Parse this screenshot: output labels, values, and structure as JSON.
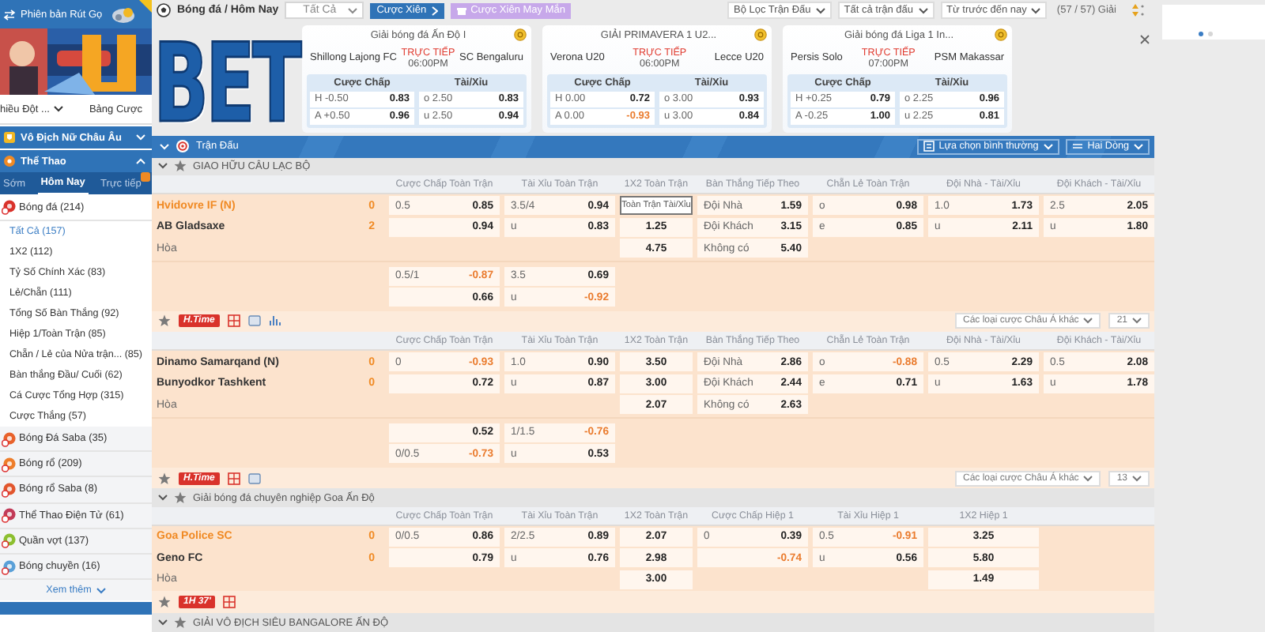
{
  "sidebar": {
    "compact_label": "Phiên bản Rút Gọ",
    "links": [
      {
        "label": "hiều Đột ...",
        "menu": true
      },
      {
        "label": "Bảng Cược",
        "menu": false
      }
    ],
    "featured": {
      "label": "Vô Địch Nữ Châu Âu",
      "expanded": false
    },
    "section": {
      "label": "Thể Thao",
      "expanded": true
    },
    "sport_tabs": [
      {
        "label": "Sớm",
        "selected": false,
        "badge": false
      },
      {
        "label": "Hôm Nay",
        "selected": true,
        "badge": false
      },
      {
        "label": "Trực tiếp",
        "selected": false,
        "badge": true
      }
    ],
    "sports": [
      {
        "label": "Bóng đá (214)",
        "kind": "soccer",
        "children": [
          {
            "label": "Tất Cả (157)",
            "selected": true
          },
          {
            "label": "1X2 (112)",
            "selected": false
          },
          {
            "label": "Tỷ Số Chính Xác (83)",
            "selected": false
          },
          {
            "label": "Lẻ/Chẵn (111)",
            "selected": false
          },
          {
            "label": "Tổng Số Bàn Thắng (92)",
            "selected": false
          },
          {
            "label": "Hiệp 1/Toàn Trận (85)",
            "selected": false
          },
          {
            "label": "Chẵn / Lẻ của Nửa trận... (85)",
            "selected": false
          },
          {
            "label": "Bàn thắng Đầu/ Cuối (62)",
            "selected": false
          },
          {
            "label": "Cá Cược Tổng Hợp (315)",
            "selected": false
          },
          {
            "label": "Cược Thắng (57)",
            "selected": false
          }
        ]
      },
      {
        "label": "Bóng Đá Saba (35)",
        "kind": "soccer-saba"
      },
      {
        "label": "Bóng rổ (209)",
        "kind": "basketball"
      },
      {
        "label": "Bóng rổ Saba (8)",
        "kind": "basketball-saba"
      },
      {
        "label": "Thể Thao Điện Tử (61)",
        "kind": "esports"
      },
      {
        "label": "Quần vợt (137)",
        "kind": "tennis"
      },
      {
        "label": "Bóng chuyền (16)",
        "kind": "volleyball"
      }
    ],
    "more": "Xem thêm"
  },
  "header": {
    "title": "Bóng đá / Hôm Nay",
    "filter": "Tất Cả",
    "buttons": [
      {
        "label": "Cược Xiên",
        "kind": "primary"
      },
      {
        "label": "Cược Xiên May Mắn",
        "kind": "lucky"
      }
    ],
    "dropdowns": [
      "Bộ Lọc Trận Đấu",
      "Tất cả trận đấu",
      "Từ trước đến nay"
    ],
    "league_count": "(57 / 57) Giải"
  },
  "logo": "BET",
  "cards": [
    {
      "league": "Giải bóng đá Ấn Độ I",
      "home": "Shillong Lajong FC",
      "away": "SC Bengaluru",
      "live": "TRỰC TIẾP",
      "time": "06:00PM",
      "handicap_title": "Cược Chấp",
      "total_title": "Tài/Xỉu",
      "rows": [
        [
          [
            "H -0.50",
            "0.83"
          ],
          [
            "o 2.50",
            "0.83"
          ]
        ],
        [
          [
            "A +0.50",
            "0.96"
          ],
          [
            "u 2.50",
            "0.94"
          ]
        ]
      ]
    },
    {
      "league": "GIẢI PRIMAVERA 1 U2...",
      "home": "Verona U20",
      "away": "Lecce U20",
      "live": "TRỰC TIẾP",
      "time": "06:00PM",
      "handicap_title": "Cược Chấp",
      "total_title": "Tài/Xỉu",
      "rows": [
        [
          [
            "H 0.00",
            "0.72"
          ],
          [
            "o 3.00",
            "0.93"
          ]
        ],
        [
          [
            "A 0.00",
            "-0.93"
          ],
          [
            "u 3.00",
            "0.84"
          ]
        ]
      ]
    },
    {
      "league": "Giải bóng đá Liga 1 In...",
      "home": "Persis Solo",
      "away": "PSM Makassar",
      "live": "TRỰC TIẾP",
      "time": "07:00PM",
      "handicap_title": "Cược Chấp",
      "total_title": "Tài/Xỉu",
      "rows": [
        [
          [
            "H +0.25",
            "0.79"
          ],
          [
            "o 2.25",
            "0.96"
          ]
        ],
        [
          [
            "A -0.25",
            "1.00"
          ],
          [
            "u 2.25",
            "0.81"
          ]
        ]
      ]
    }
  ],
  "carousel": [
    {
      "selected": true
    },
    {
      "selected": false
    }
  ],
  "board": {
    "title": "Trận Đấu",
    "options": [
      {
        "label": "Lựa chọn bình thường",
        "kind": "list"
      },
      {
        "label": "Hai Dòng",
        "kind": "lines"
      }
    ],
    "leagues": [
      {
        "name": "GIAO HỮU CÂU LẠC BỘ",
        "matches": [
          {
            "columns": [
              {
                "title": "Cược Chấp Toàn Trận",
                "kind": "pair"
              },
              {
                "title": "Tài Xỉu Toàn Trận",
                "kind": "pair"
              },
              {
                "title": "1X2 Toàn Trận",
                "kind": "single"
              },
              {
                "title": "Bàn Thắng Tiếp Theo",
                "kind": "pair"
              },
              {
                "title": "Chẵn Lẻ Toàn Trận",
                "kind": "pair"
              },
              {
                "title": "Đội Nhà - Tài/Xỉu",
                "kind": "pair"
              },
              {
                "title": "Đội Khách - Tài/Xỉu",
                "kind": "pair"
              }
            ],
            "home": {
              "name": "Hvidovre IF (N)",
              "score": "0",
              "highlight": true
            },
            "away": {
              "name": "AB Gladsaxe",
              "score": "2",
              "highlight": false
            },
            "draw": "Hòa",
            "rows": [
              [
                [
                  "0.5",
                  "0.85"
                ],
                [
                  "3.5/4",
                  "0.94"
                ],
                {
                  "tooltip": "Toàn Trận Tài/Xỉu"
                },
                [
                  "Đội Nhà",
                  "1.59"
                ],
                [
                  "o",
                  "0.98"
                ],
                [
                  "1.0",
                  "1.73"
                ],
                [
                  "2.5",
                  "2.05"
                ]
              ],
              [
                [
                  "0.94"
                ],
                [
                  "u",
                  "0.83"
                ],
                [
                  "1.25"
                ],
                [
                  "Đội Khách",
                  "3.15"
                ],
                [
                  "e",
                  "0.85"
                ],
                [
                  "u",
                  "2.11"
                ],
                [
                  "u",
                  "1.80"
                ]
              ],
              [
                null,
                null,
                [
                  "4.75"
                ],
                [
                  "Không có",
                  "5.40"
                ],
                null,
                null,
                null
              ]
            ],
            "extra_rows": [
              [
                [
                  "0.5/1",
                  "-0.87"
                ],
                [
                  "3.5",
                  "0.69"
                ]
              ],
              [
                [
                  "0.66"
                ],
                [
                  "u",
                  "-0.92"
                ]
              ]
            ],
            "badge": "H.Time",
            "tools": [
              {
                "kind": "grid"
              },
              {
                "kind": "box"
              },
              {
                "kind": "chart"
              }
            ],
            "more": {
              "label": "Các loại cược Châu Á khác",
              "count": "21"
            }
          },
          {
            "columns": [
              {
                "title": "Cược Chấp Toàn Trận",
                "kind": "pair"
              },
              {
                "title": "Tài Xỉu Toàn Trận",
                "kind": "pair"
              },
              {
                "title": "1X2 Toàn Trận",
                "kind": "single"
              },
              {
                "title": "Bàn Thắng Tiếp Theo",
                "kind": "pair"
              },
              {
                "title": "Chẵn Lẻ Toàn Trận",
                "kind": "pair"
              },
              {
                "title": "Đội Nhà - Tài/Xỉu",
                "kind": "pair"
              },
              {
                "title": "Đội Khách - Tài/Xỉu",
                "kind": "pair"
              }
            ],
            "home": {
              "name": "Dinamo Samarqand (N)",
              "score": "0",
              "highlight": false
            },
            "away": {
              "name": "Bunyodkor Tashkent",
              "score": "0",
              "highlight": false
            },
            "draw": "Hòa",
            "rows": [
              [
                [
                  "0",
                  "-0.93"
                ],
                [
                  "1.0",
                  "0.90"
                ],
                [
                  "3.50"
                ],
                [
                  "Đội Nhà",
                  "2.86"
                ],
                [
                  "o",
                  "-0.88"
                ],
                [
                  "0.5",
                  "2.29"
                ],
                [
                  "0.5",
                  "2.08"
                ]
              ],
              [
                [
                  "0.72"
                ],
                [
                  "u",
                  "0.87"
                ],
                [
                  "3.00"
                ],
                [
                  "Đội Khách",
                  "2.44"
                ],
                [
                  "e",
                  "0.71"
                ],
                [
                  "u",
                  "1.63"
                ],
                [
                  "u",
                  "1.78"
                ]
              ],
              [
                null,
                null,
                [
                  "2.07"
                ],
                [
                  "Không có",
                  "2.63"
                ],
                null,
                null,
                null
              ]
            ],
            "extra_rows": [
              [
                [
                  "0.52"
                ],
                [
                  "1/1.5",
                  "-0.76"
                ]
              ],
              [
                [
                  "0/0.5",
                  "-0.73"
                ],
                [
                  "u",
                  "0.53"
                ]
              ]
            ],
            "badge": "H.Time",
            "tools": [
              {
                "kind": "grid"
              },
              {
                "kind": "box"
              }
            ],
            "more": {
              "label": "Các loại cược Châu Á khác",
              "count": "13"
            }
          }
        ]
      },
      {
        "name": "Giải bóng đá chuyên nghiệp Goa Ấn Độ",
        "matches": [
          {
            "columns": [
              {
                "title": "Cược Chấp Toàn Trận",
                "kind": "pair"
              },
              {
                "title": "Tài Xỉu Toàn Trận",
                "kind": "pair"
              },
              {
                "title": "1X2 Toàn Trận",
                "kind": "single"
              },
              {
                "title": "Cược Chấp Hiệp 1",
                "kind": "pair"
              },
              {
                "title": "Tài Xỉu Hiệp 1",
                "kind": "pair"
              },
              {
                "title": "1X2 Hiệp 1",
                "kind": "single"
              }
            ],
            "home": {
              "name": "Goa Police SC",
              "score": "0",
              "highlight": true
            },
            "away": {
              "name": "Geno FC",
              "score": "0",
              "highlight": false
            },
            "draw": "Hòa",
            "rows": [
              [
                [
                  "0/0.5",
                  "0.86"
                ],
                [
                  "2/2.5",
                  "0.89"
                ],
                [
                  "2.07"
                ],
                [
                  "0",
                  "0.39"
                ],
                [
                  "0.5",
                  "-0.91"
                ],
                [
                  "3.25"
                ]
              ],
              [
                [
                  "0.79"
                ],
                [
                  "u",
                  "0.76"
                ],
                [
                  "2.98"
                ],
                [
                  "-0.74"
                ],
                [
                  "u",
                  "0.56"
                ],
                [
                  "5.80"
                ]
              ],
              [
                null,
                null,
                [
                  "3.00"
                ],
                null,
                null,
                [
                  "1.49"
                ]
              ]
            ],
            "badge": "1H 37'",
            "tools": [
              {
                "kind": "grid"
              }
            ]
          }
        ]
      },
      {
        "name": "GIẢI VÔ ĐỊCH SIÊU BANGALORE ẤN ĐỘ"
      }
    ]
  }
}
